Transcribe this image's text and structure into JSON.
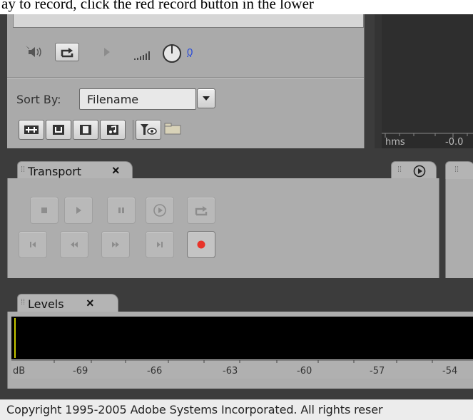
{
  "instruction_text": "ay to record, click the red record button in the lower",
  "files_panel": {
    "volume_value": "0",
    "sort_by_label": "Sort By:",
    "sort_by_value": "Filename",
    "display_options": [
      "track-icon",
      "loop-icon",
      "film-icon",
      "music-note-icon",
      "filter-eye-icon",
      "folder-icon"
    ]
  },
  "display_panel": {
    "time_format": "hms",
    "time_value": "-0.0"
  },
  "transport": {
    "tab_label": "Transport",
    "close_label": "×",
    "buttons_row1": [
      "stop",
      "play",
      "pause",
      "play-from-cursor",
      "loop"
    ],
    "buttons_row2": [
      "go-to-start",
      "rewind",
      "fast-forward",
      "go-to-end",
      "record"
    ],
    "record_color": "#e8342a"
  },
  "levels": {
    "tab_label": "Levels",
    "close_label": "×",
    "unit_label": "dB",
    "ticks": [
      "-69",
      "-66",
      "-63",
      "-60",
      "-57",
      "-54"
    ],
    "indicator_color": "#c8c800"
  },
  "status": {
    "copyright": "Copyright 1995-2005 Adobe Systems Incorporated. All rights reser"
  }
}
